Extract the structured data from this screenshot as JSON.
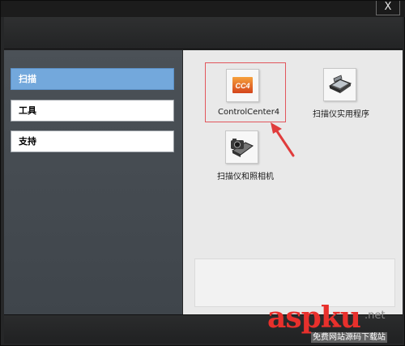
{
  "window": {
    "close_label": "X"
  },
  "sidebar": {
    "items": [
      {
        "label": "扫描",
        "active": true
      },
      {
        "label": "工具",
        "active": false
      },
      {
        "label": "支持",
        "active": false
      }
    ]
  },
  "content": {
    "apps": [
      {
        "label": "ControlCenter4",
        "icon": "controlcenter4-icon",
        "icon_text": "CC4",
        "selected": true
      },
      {
        "label": "扫描仪实用程序",
        "icon": "scanner-icon",
        "selected": false
      },
      {
        "label": "扫描仪和照相机",
        "icon": "camera-scanner-icon",
        "selected": false
      }
    ]
  },
  "watermark": {
    "brand": "aspku",
    "tld": ".net",
    "tagline": "免费网站源码下载站"
  },
  "colors": {
    "active_nav": "#73a8dc",
    "highlight_border": "#e2565c",
    "arrow": "#e03c3c",
    "watermark": "#e8302c"
  }
}
